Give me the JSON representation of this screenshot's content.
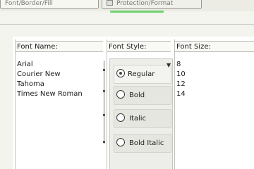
{
  "tabs": [
    {
      "label": "Font/Border/Fill"
    },
    {
      "label": "Protection/Format"
    }
  ],
  "columns": {
    "font_name": "Font Name:",
    "font_style": "Font Style:",
    "font_size": "Font Size:"
  },
  "font_names": [
    "Arial",
    "Courier New",
    "Tahoma",
    "Times New Roman"
  ],
  "font_sizes": [
    "8",
    "10",
    "12",
    "14"
  ],
  "font_styles": [
    {
      "label": "Regular",
      "selected": true
    },
    {
      "label": "Bold",
      "selected": false
    },
    {
      "label": "Italic",
      "selected": false
    },
    {
      "label": "Bold Italic",
      "selected": false
    }
  ],
  "accent_color": "#6fd36f"
}
